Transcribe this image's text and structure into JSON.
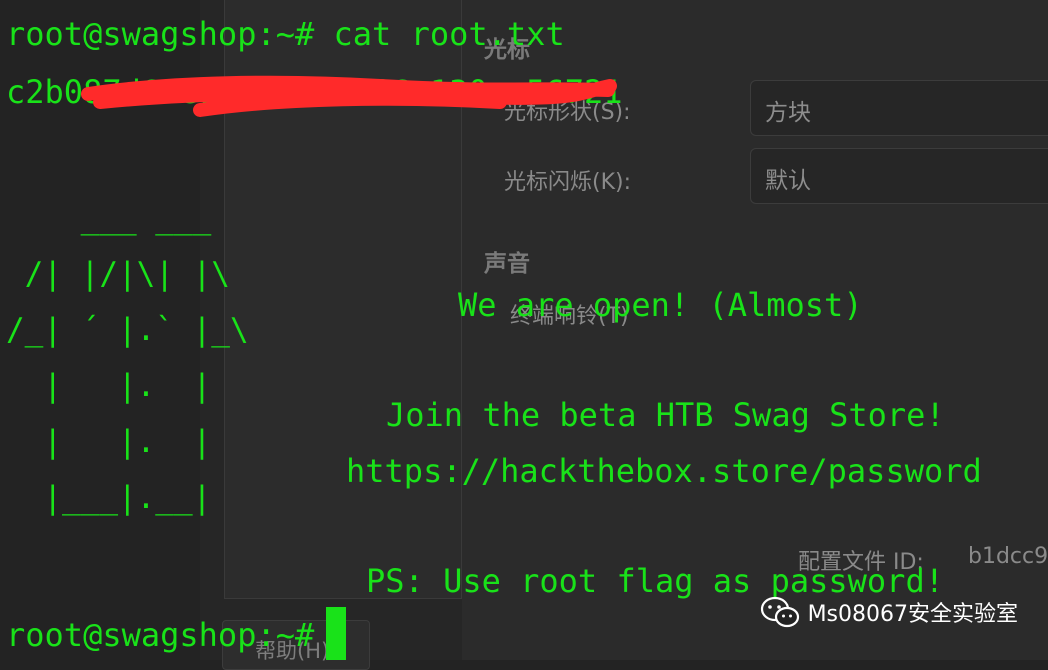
{
  "settings_dialog": {
    "cursor_heading": "光标",
    "cursor_shape_label": "光标形状(S):",
    "cursor_shape_value": "方块",
    "cursor_blink_label": "光标闪烁(K):",
    "cursor_blink_value": "默认",
    "sound_heading": "声音",
    "sound_option_label": "终端响铃(T)",
    "profile_id_label": "配置文件 ID:",
    "profile_id_value": "b1dcc9",
    "help_button_label": "帮助(H)"
  },
  "terminal": {
    "command_line": "root@swagshop:~# cat root.txt",
    "flag_output": "c2b087d66e14a652a3b86a130ac56721",
    "ascii_art": [
      "    ___ ___",
      " /| |/|\\| |\\",
      "/_| ´ |.` |_\\",
      "  |   |.  |",
      "  |   |.  |",
      "  |___|.__|"
    ],
    "motd_open": "We are open! (Almost)",
    "motd_join": "Join the beta HTB Swag Store!",
    "motd_url": "https://hackthebox.store/password",
    "motd_ps": "PS: Use root flag as password!",
    "prompt": "root@swagshop:~#"
  },
  "watermark": {
    "text": "Ms08067安全实验室",
    "icon": "wechat-icon"
  },
  "colors": {
    "terminal_green": "#19e219",
    "redaction_red": "#ff2a2a",
    "background": "#232323"
  }
}
